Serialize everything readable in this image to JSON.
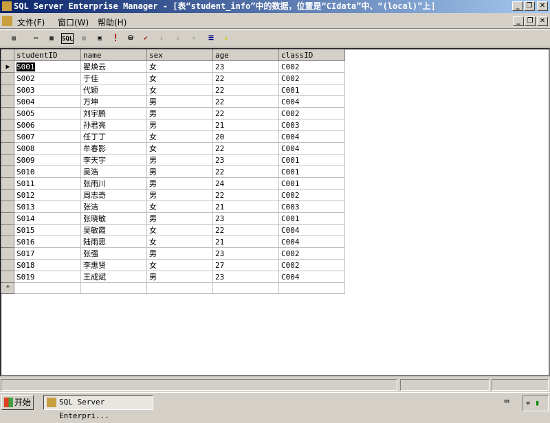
{
  "window": {
    "title": "SQL Server Enterprise Manager - [表“student_info”中的数据，位置是“CIdata”中、“(local)”上]"
  },
  "menu": [
    {
      "label": "文件(F)"
    },
    {
      "label": "窗口(W)"
    },
    {
      "label": "帮助(H)"
    }
  ],
  "toolbar": {
    "sql_label": "SQL",
    "icons": [
      "properties-icon",
      "show-diagram-icon",
      "show-grid-icon",
      "show-sql-icon",
      "show-results-icon",
      "change-query-type-icon",
      "run-icon",
      "verify-sql-icon",
      "remove-filter-icon",
      "sort-ascending-icon",
      "sort-descending-icon",
      "group-by-icon",
      "add-table-icon"
    ]
  },
  "grid": {
    "columns": [
      "studentID",
      "name",
      "sex",
      "age",
      "classID"
    ],
    "rows": [
      [
        "S001",
        "翟焕云",
        "女",
        "23",
        "C002"
      ],
      [
        "S002",
        "于佳",
        "女",
        "22",
        "C002"
      ],
      [
        "S003",
        "代颖",
        "女",
        "22",
        "C001"
      ],
      [
        "S004",
        "万坤",
        "男",
        "22",
        "C004"
      ],
      [
        "S005",
        "刘宇鹏",
        "男",
        "22",
        "C002"
      ],
      [
        "S006",
        "孙君亮",
        "男",
        "21",
        "C003"
      ],
      [
        "S007",
        "任丁丁",
        "女",
        "20",
        "C004"
      ],
      [
        "S008",
        "牟春影",
        "女",
        "22",
        "C004"
      ],
      [
        "S009",
        "李天宇",
        "男",
        "23",
        "C001"
      ],
      [
        "S010",
        "吴浩",
        "男",
        "22",
        "C001"
      ],
      [
        "S011",
        "张雨川",
        "男",
        "24",
        "C001"
      ],
      [
        "S012",
        "周志奇",
        "男",
        "22",
        "C002"
      ],
      [
        "S013",
        "张洁",
        "女",
        "21",
        "C003"
      ],
      [
        "S014",
        "张晓敏",
        "男",
        "23",
        "C001"
      ],
      [
        "S015",
        "吴敏霞",
        "女",
        "22",
        "C004"
      ],
      [
        "S016",
        "陆雨思",
        "女",
        "21",
        "C004"
      ],
      [
        "S017",
        "张强",
        "男",
        "23",
        "C002"
      ],
      [
        "S018",
        "李惠贤",
        "女",
        "27",
        "C002"
      ],
      [
        "S019",
        "王成斌",
        "男",
        "23",
        "C004"
      ]
    ],
    "current_marker": "▶",
    "new_row_marker": "*"
  },
  "taskbar": {
    "start_label": "开始",
    "task_label": "SQL Server Enterpri..."
  }
}
